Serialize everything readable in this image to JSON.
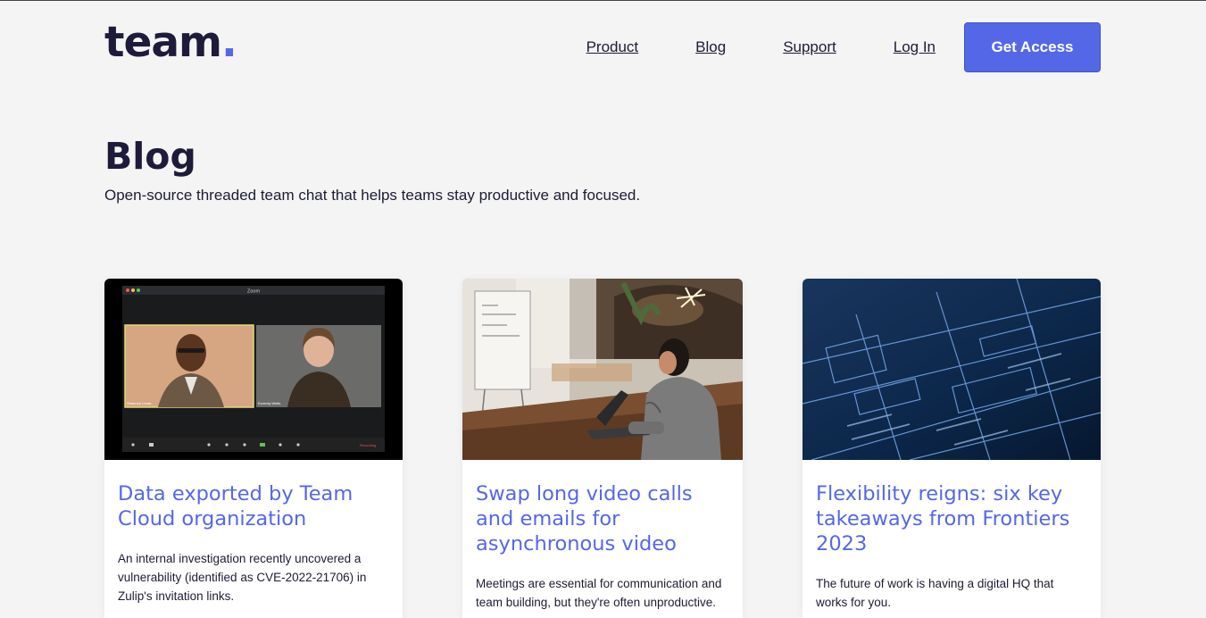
{
  "brand": {
    "logo_text": "team",
    "logo_dot": "."
  },
  "nav": {
    "items": [
      "Product",
      "Blog",
      "Support",
      "Log In"
    ],
    "cta": "Get Access"
  },
  "page": {
    "title": "Blog",
    "subtitle": "Open-source threaded team chat that helps teams stay productive and focused."
  },
  "zoom_mock": {
    "window_title": "Zoom",
    "participants": [
      "Shannon Lewis",
      "Ezremly Wells"
    ],
    "recording_label": "Recording"
  },
  "posts": [
    {
      "title": "Data exported by Team Cloud organization",
      "excerpt": "An internal investigation recently uncovered a vulnerability (identified as CVE-2022-21706) in Zulip's invitation links.",
      "image": "video-call-screenshot"
    },
    {
      "title": "Swap long video calls and emails for asynchronous video",
      "excerpt": "Meetings are essential for communication and team building, but they're often unproductive.",
      "image": "woman-working-on-laptop"
    },
    {
      "title": "Flexibility reigns: six key takeaways from Frontiers 2023",
      "excerpt": "The future of work is having a digital HQ that works for you.",
      "image": "blueprint-wireframes"
    }
  ],
  "colors": {
    "accent": "#5468e7",
    "text": "#1c1c35",
    "background": "#f4f4f5"
  }
}
